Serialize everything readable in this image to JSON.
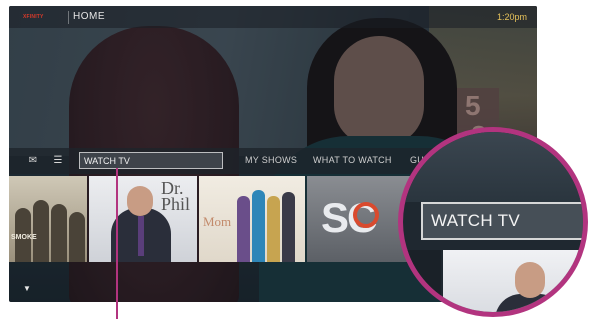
{
  "header": {
    "logo_text": "XFINITY",
    "title": "HOME",
    "time": "1:20pm"
  },
  "nav": {
    "icons": [
      "mail-icon",
      "menu-icon"
    ],
    "search_label": "WATCH TV",
    "links": [
      "MY SHOWS",
      "WHAT TO WATCH",
      "GU"
    ]
  },
  "shows": {
    "tile1_text": "SMOKE",
    "tile2_text": "Dr. Phil",
    "tile3_text": "Mom",
    "tile4_text": "SC"
  },
  "scene_numbers": [
    "5",
    "2"
  ],
  "magnifier": {
    "label": "WATCH TV"
  },
  "colors": {
    "accent": "#b2347f",
    "clock": "#e6c25a",
    "logo": "#d83a2a"
  }
}
